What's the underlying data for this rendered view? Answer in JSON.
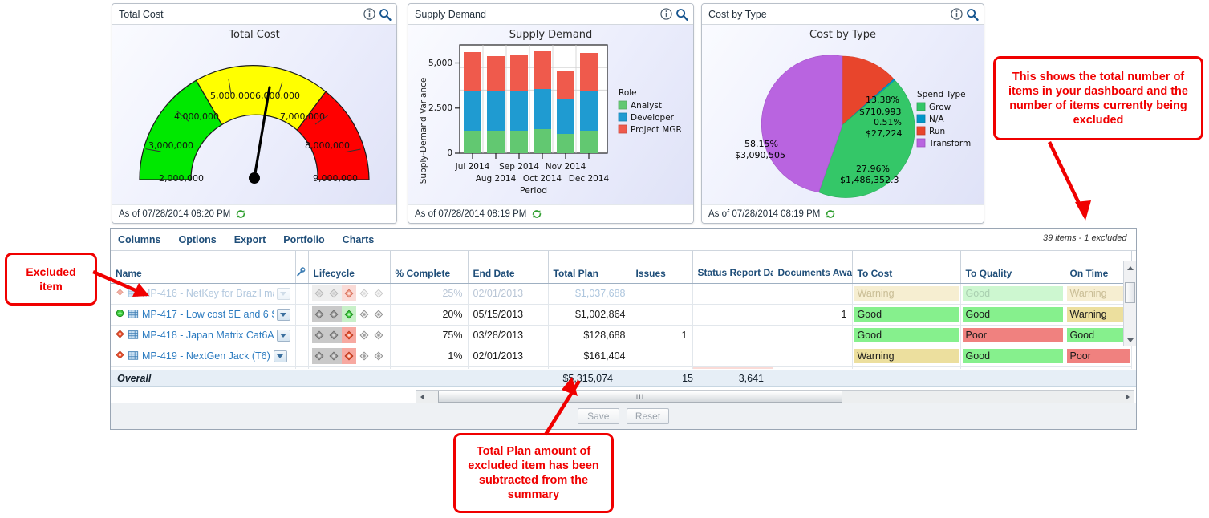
{
  "panels": [
    {
      "id": "total-cost",
      "header": "Total Cost",
      "chart_title": "Total Cost",
      "footer": "As of 07/28/2014 08:20 PM"
    },
    {
      "id": "supply-demand",
      "header": "Supply Demand",
      "chart_title": "Supply Demand",
      "footer": "As of 07/28/2014 08:19 PM"
    },
    {
      "id": "cost-by-type",
      "header": "Cost by Type",
      "chart_title": "Cost by Type",
      "footer": "As of 07/28/2014 08:19 PM"
    }
  ],
  "icons": {
    "info": "info-icon",
    "search": "search-icon",
    "refresh": "refresh-icon",
    "wrench": "wrench-icon"
  },
  "chart_data": [
    {
      "type": "gauge",
      "title": "Total Cost",
      "value": 6200000,
      "min": 2000000,
      "max": 9000000,
      "tick_labels": [
        "2,000,000",
        "3,000,000",
        "4,000,000",
        "5,000,000",
        "6,000,000",
        "7,000,000",
        "8,000,000",
        "9,000,000"
      ],
      "bands": [
        {
          "from": 2000000,
          "to": 4700000,
          "color": "#00e800"
        },
        {
          "from": 4700000,
          "to": 7000000,
          "color": "#ffff00"
        },
        {
          "from": 7000000,
          "to": 9000000,
          "color": "#ff0000"
        }
      ]
    },
    {
      "type": "bar",
      "stacked": true,
      "title": "Supply Demand",
      "xlabel": "Period",
      "ylabel": "Supply-Demand Variance",
      "categories": [
        "Jul 2014",
        "Aug 2014",
        "Sep 2014",
        "Oct 2014",
        "Nov 2014",
        "Dec 2014"
      ],
      "ytick_labels": [
        "0",
        "2,500",
        "5,000"
      ],
      "ylim": [
        0,
        6000
      ],
      "legend_title": "Role",
      "series": [
        {
          "name": "Analyst",
          "color": "#62c871",
          "values": [
            1250,
            1270,
            1260,
            1320,
            1100,
            1250
          ]
        },
        {
          "name": "Developer",
          "color": "#1f9bd1",
          "values": [
            2200,
            2180,
            2200,
            2230,
            1900,
            2170
          ]
        },
        {
          "name": "Project MGR",
          "color": "#ef5a4c",
          "values": [
            2150,
            1950,
            1970,
            2100,
            1600,
            2080
          ]
        }
      ]
    },
    {
      "type": "pie",
      "title": "Cost by Type",
      "legend_title": "Spend Type",
      "slices": [
        {
          "name": "Run",
          "percent": 13.38,
          "label_pct": "13.38%",
          "label_val": "$710,993",
          "color": "#e8452c"
        },
        {
          "name": "N/A",
          "percent": 0.51,
          "label_pct": "0.51%",
          "label_val": "$27,224",
          "color": "#0096c8"
        },
        {
          "name": "Grow",
          "percent": 27.96,
          "label_pct": "27.96%",
          "label_val": "$1,486,352.3",
          "color": "#34c768"
        },
        {
          "name": "Transform",
          "percent": 58.15,
          "label_pct": "58.15%",
          "label_val": "$3,090,505",
          "color": "#b964e0"
        }
      ],
      "legend": [
        {
          "name": "Grow",
          "color": "#34c768"
        },
        {
          "name": "N/A",
          "color": "#0096c8"
        },
        {
          "name": "Run",
          "color": "#e8452c"
        },
        {
          "name": "Transform",
          "color": "#b964e0"
        }
      ]
    }
  ],
  "toolbar": {
    "items": [
      "Columns",
      "Options",
      "Export",
      "Portfolio",
      "Charts"
    ],
    "items_count": "39 items - 1 excluded"
  },
  "grid": {
    "columns": [
      "Name",
      "Lifecycle",
      "% Complete",
      "End Date",
      "Total Plan",
      "Issues",
      "Status Report Days Late",
      "Documents Awaiting",
      "To Cost",
      "To Quality",
      "On Time"
    ],
    "rows": [
      {
        "excluded": true,
        "name": "MP-416 - NetKey for Brazil ma",
        "pct": "25%",
        "end": "02/01/2013",
        "plan": "$1,037,688",
        "issues": "",
        "late": "",
        "docs": "",
        "cost": "Warning",
        "quality": "Good",
        "ontime": "Warning"
      },
      {
        "excluded": false,
        "name": "MP-417 - Low cost 5E and 6 S",
        "pct": "20%",
        "end": "05/15/2013",
        "plan": "$1,002,864",
        "issues": "",
        "late": "",
        "docs": "1",
        "cost": "Good",
        "quality": "Good",
        "ontime": "Warning"
      },
      {
        "excluded": false,
        "name": "MP-418 - Japan Matrix Cat6A",
        "pct": "75%",
        "end": "03/28/2013",
        "plan": "$128,688",
        "issues": "1",
        "late": "",
        "docs": "",
        "cost": "Good",
        "quality": "Poor",
        "ontime": "Good"
      },
      {
        "excluded": false,
        "name": "MP-419 - NextGen Jack (T6)",
        "pct": "1%",
        "end": "02/01/2013",
        "plan": "$161,404",
        "issues": "",
        "late": "",
        "docs": "",
        "cost": "Warning",
        "quality": "Good",
        "ontime": "Poor"
      }
    ],
    "overall": {
      "label": "Overall",
      "plan": "$5,315,074",
      "issues": "15",
      "late": "3,641"
    }
  },
  "footer_buttons": {
    "save": "Save",
    "reset": "Reset"
  },
  "callouts": {
    "right": "This shows the total number of items in your dashboard and the number of items currently being excluded",
    "left": "Excluded item",
    "bottom": "Total Plan amount of excluded item has been subtracted from the summary"
  },
  "colors": {
    "accent": "#1f4e79",
    "link": "#2b7bc0",
    "callout": "#f00000",
    "good": "#86f08d",
    "warning": "#ecdf9e",
    "poor": "#f0817f"
  }
}
